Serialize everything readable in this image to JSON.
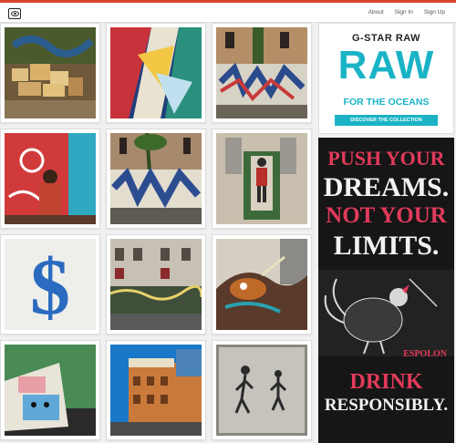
{
  "header": {
    "logo_icon": "eye-icon",
    "nav": [
      {
        "label": "About"
      },
      {
        "label": "Sign In"
      },
      {
        "label": "Sign Up"
      }
    ],
    "accent_color": "#d8452f"
  },
  "grid": {
    "tiles": [
      {
        "subject": "graffiti-wall-with-boxes"
      },
      {
        "subject": "graffiti-geometric-mural"
      },
      {
        "subject": "graffiti-street-wall"
      },
      {
        "subject": "artist-painting-mural"
      },
      {
        "subject": "graffiti-wall-palms"
      },
      {
        "subject": "stencil-art-on-box"
      },
      {
        "subject": "dollar-sign-art"
      },
      {
        "subject": "building-mural"
      },
      {
        "subject": "graffiti-creature"
      },
      {
        "subject": "sticker-art"
      },
      {
        "subject": "building-sky"
      },
      {
        "subject": "stencil-figures"
      }
    ]
  },
  "ads": {
    "gstar": {
      "brand": "G-STAR RAW",
      "headline": "RAW",
      "tagline": "FOR THE OCEANS",
      "cta": "DISCOVER THE COLLECTION",
      "color": "#1ab3c6"
    },
    "espolon": {
      "line1": "PUSH YOUR",
      "line2": "DREAMS.",
      "line3": "NOT YOUR",
      "line4": "LIMITS.",
      "brand": "ESPOLON",
      "line5": "DRINK",
      "line6": "RESPONSIBLY."
    }
  }
}
